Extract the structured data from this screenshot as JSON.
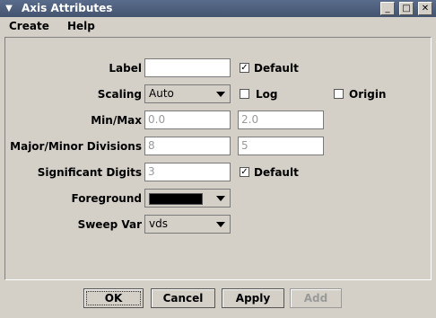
{
  "window": {
    "title": "Axis Attributes",
    "menu_icon": "chevron-down-icon"
  },
  "menubar": {
    "items": [
      "Create",
      "Help"
    ]
  },
  "form": {
    "label": {
      "label": "Label",
      "value": "",
      "default_checked": true,
      "default_label": "Default"
    },
    "scaling": {
      "label": "Scaling",
      "value": "Auto",
      "log_checked": false,
      "log_label": "Log",
      "origin_checked": false,
      "origin_label": "Origin"
    },
    "minmax": {
      "label": "Min/Max",
      "min": "0.0",
      "max": "2.0"
    },
    "divisions": {
      "label": "Major/Minor Divisions",
      "major": "8",
      "minor": "5"
    },
    "digits": {
      "label": "Significant Digits",
      "value": "3",
      "default_checked": true,
      "default_label": "Default"
    },
    "foreground": {
      "label": "Foreground",
      "color": "#000000"
    },
    "sweep": {
      "label": "Sweep Var",
      "value": "vds"
    }
  },
  "buttons": {
    "ok": "OK",
    "cancel": "Cancel",
    "apply": "Apply",
    "add": "Add"
  }
}
